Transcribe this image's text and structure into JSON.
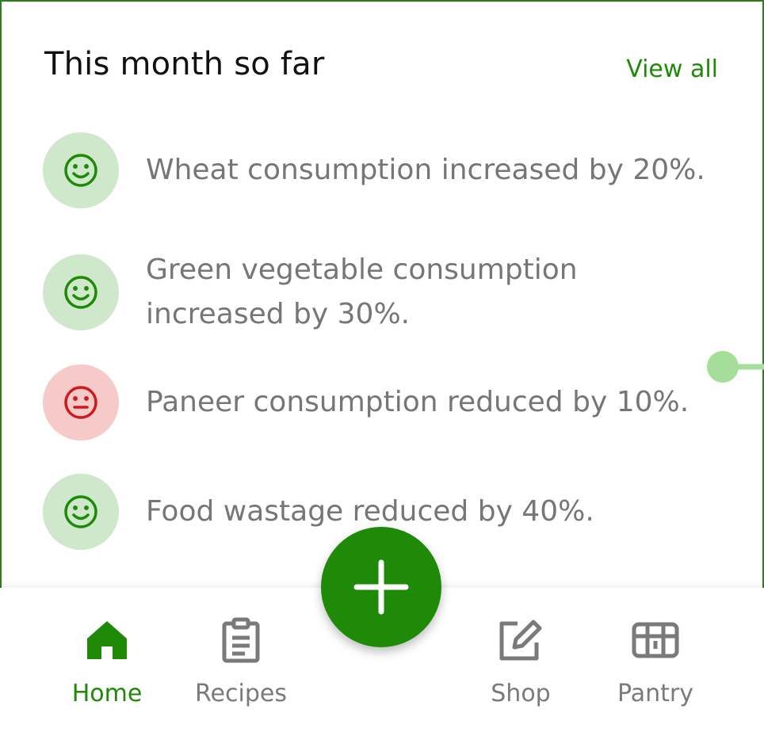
{
  "header": {
    "title": "This month so far",
    "view_all_label": "View all"
  },
  "insights": [
    {
      "text": "Wheat consumption increased by 20%.",
      "mood": "happy"
    },
    {
      "text": "Green vegetable consumption increased by 30%.",
      "mood": "happy"
    },
    {
      "text": "Paneer consumption reduced by 10%.",
      "mood": "neutral"
    },
    {
      "text": "Food wastage reduced by 40%.",
      "mood": "happy"
    }
  ],
  "bottom_nav": {
    "items": [
      {
        "label": "Home",
        "icon": "home-icon",
        "active": true
      },
      {
        "label": "Recipes",
        "icon": "clipboard-icon",
        "active": false
      },
      {
        "label": "Shop",
        "icon": "edit-icon",
        "active": false
      },
      {
        "label": "Pantry",
        "icon": "pantry-icon",
        "active": false
      }
    ],
    "fab_icon": "plus-icon"
  },
  "colors": {
    "accent": "#1e8a07",
    "happy_bg": "#cfe8cb",
    "neutral_bg": "#f7caca",
    "neutral_fg": "#d0181f",
    "muted_text": "#767676"
  }
}
